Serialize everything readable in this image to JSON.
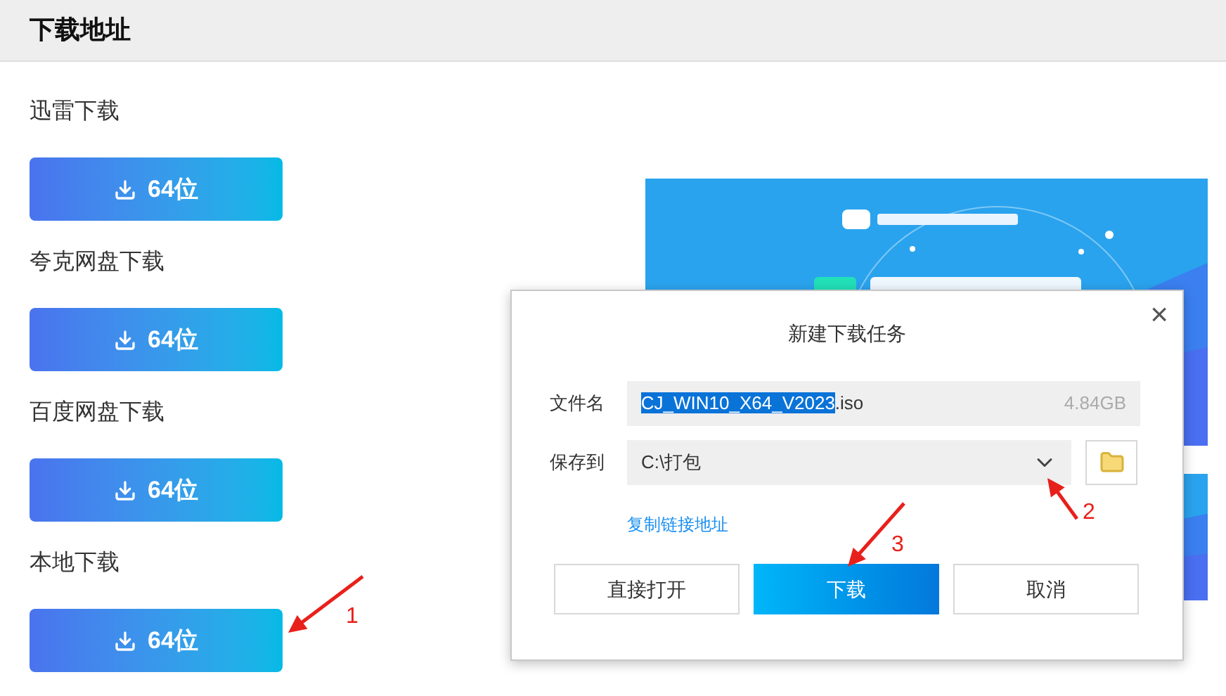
{
  "header": {
    "title": "下载地址"
  },
  "sections": [
    {
      "label": "迅雷下载",
      "button": "64位"
    },
    {
      "label": "夸克网盘下载",
      "button": "64位"
    },
    {
      "label": "百度网盘下载",
      "button": "64位"
    },
    {
      "label": "本地下载",
      "button": "64位"
    }
  ],
  "dialog": {
    "title": "新建下载任务",
    "close": "×",
    "filename": {
      "label": "文件名",
      "selected_text": "CJ_WIN10_X64_V2023",
      "rest_text": ".iso",
      "size": "4.84GB"
    },
    "save_to": {
      "label": "保存到",
      "value": "C:\\打包"
    },
    "link": "复制链接地址",
    "buttons": [
      {
        "label": "直接打开",
        "primary": false
      },
      {
        "label": "下载",
        "primary": true
      },
      {
        "label": "取消",
        "primary": false
      }
    ]
  },
  "annotations": [
    {
      "label": "1"
    },
    {
      "label": "2"
    },
    {
      "label": "3"
    }
  ]
}
